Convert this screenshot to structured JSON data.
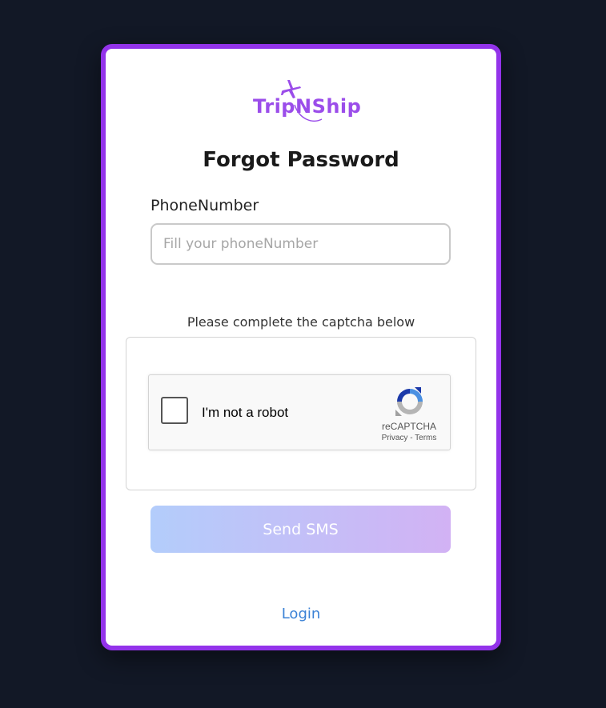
{
  "brand": {
    "logo_text": "TripNShip",
    "logo_color": "#9b4dea",
    "accent_color": "#9333ea"
  },
  "form": {
    "title": "Forgot Password",
    "phone_label": "PhoneNumber",
    "phone_placeholder": "Fill your phoneNumber",
    "phone_value": "",
    "captcha_prompt": "Please complete the captcha below"
  },
  "recaptcha": {
    "checkbox_label": "I'm not a robot",
    "checked": false,
    "brand": "reCAPTCHA",
    "privacy_label": "Privacy",
    "separator": " - ",
    "terms_label": "Terms"
  },
  "actions": {
    "send_label": "Send SMS",
    "login_label": "Login"
  },
  "icons": {
    "logo_plane": "airplane-icon",
    "recaptcha_logo": "recaptcha-logo-icon"
  }
}
